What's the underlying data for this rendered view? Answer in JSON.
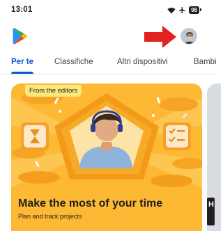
{
  "status_bar": {
    "time": "13:01",
    "battery": "98"
  },
  "header": {
    "logo_icon": "google-play-logo",
    "annotation": "red-arrow",
    "avatar": "profile-avatar"
  },
  "tabs": [
    {
      "label": "Per te",
      "active": true
    },
    {
      "label": "Classifiche",
      "active": false
    },
    {
      "label": "Altri dispositivi",
      "active": false
    },
    {
      "label": "Bambi",
      "active": false
    }
  ],
  "banner": {
    "chip": "From the editors",
    "title": "Make the most of your time",
    "subtitle": "Plan and track projects"
  },
  "next_card": {
    "letter": "H"
  },
  "colors": {
    "accent": "#0b57d0",
    "banner": "#fdb933",
    "arrow": "#e32222"
  }
}
